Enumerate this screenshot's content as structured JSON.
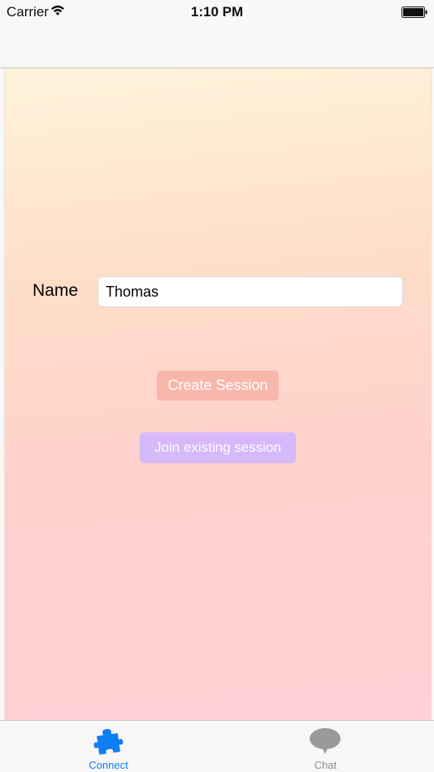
{
  "status_bar": {
    "carrier": "Carrier",
    "time": "1:10 PM",
    "wifi_icon": "wifi-icon",
    "battery_icon": "battery-icon"
  },
  "form": {
    "name_label": "Name",
    "name_value": "Thomas",
    "name_placeholder": ""
  },
  "buttons": {
    "create_session": "Create Session",
    "join_session": "Join existing session"
  },
  "tab_bar": {
    "items": [
      {
        "label": "Connect",
        "icon": "puzzle-piece-icon",
        "selected": true
      },
      {
        "label": "Chat",
        "icon": "speech-bubble-icon",
        "selected": false
      }
    ]
  },
  "colors": {
    "accent_blue": "#0f7df4",
    "create_button": "#f9b6ab",
    "join_button": "#d5b9fb"
  }
}
